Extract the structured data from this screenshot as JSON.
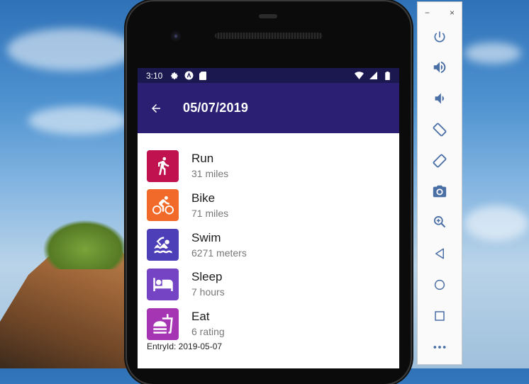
{
  "status_bar": {
    "time": "3:10"
  },
  "app_bar": {
    "title": "05/07/2019"
  },
  "activities": [
    {
      "title": "Run",
      "subtitle": "31 miles",
      "icon": "run-icon",
      "color": "#c0124f"
    },
    {
      "title": "Bike",
      "subtitle": "71 miles",
      "icon": "bike-icon",
      "color": "#f26a29"
    },
    {
      "title": "Swim",
      "subtitle": "6271 meters",
      "icon": "swim-icon",
      "color": "#4c3fb8"
    },
    {
      "title": "Sleep",
      "subtitle": "7 hours",
      "icon": "sleep-icon",
      "color": "#7444c4"
    },
    {
      "title": "Eat",
      "subtitle": "6 rating",
      "icon": "food-icon",
      "color": "#a635b3"
    }
  ],
  "entry": {
    "label": "EntryId: 2019-05-07"
  },
  "emulator_toolbar": {
    "minimize": "−",
    "close": "×",
    "buttons": [
      "power-icon",
      "volume-up-icon",
      "volume-down-icon",
      "rotate-left-icon",
      "rotate-right-icon",
      "camera-icon",
      "zoom-icon",
      "back-triangle-icon",
      "home-circle-icon",
      "overview-square-icon",
      "more-icon"
    ],
    "icon_color": "#4a6fa5"
  },
  "colors": {
    "status_bar": "#1b1850",
    "app_bar": "#2a1f73"
  }
}
